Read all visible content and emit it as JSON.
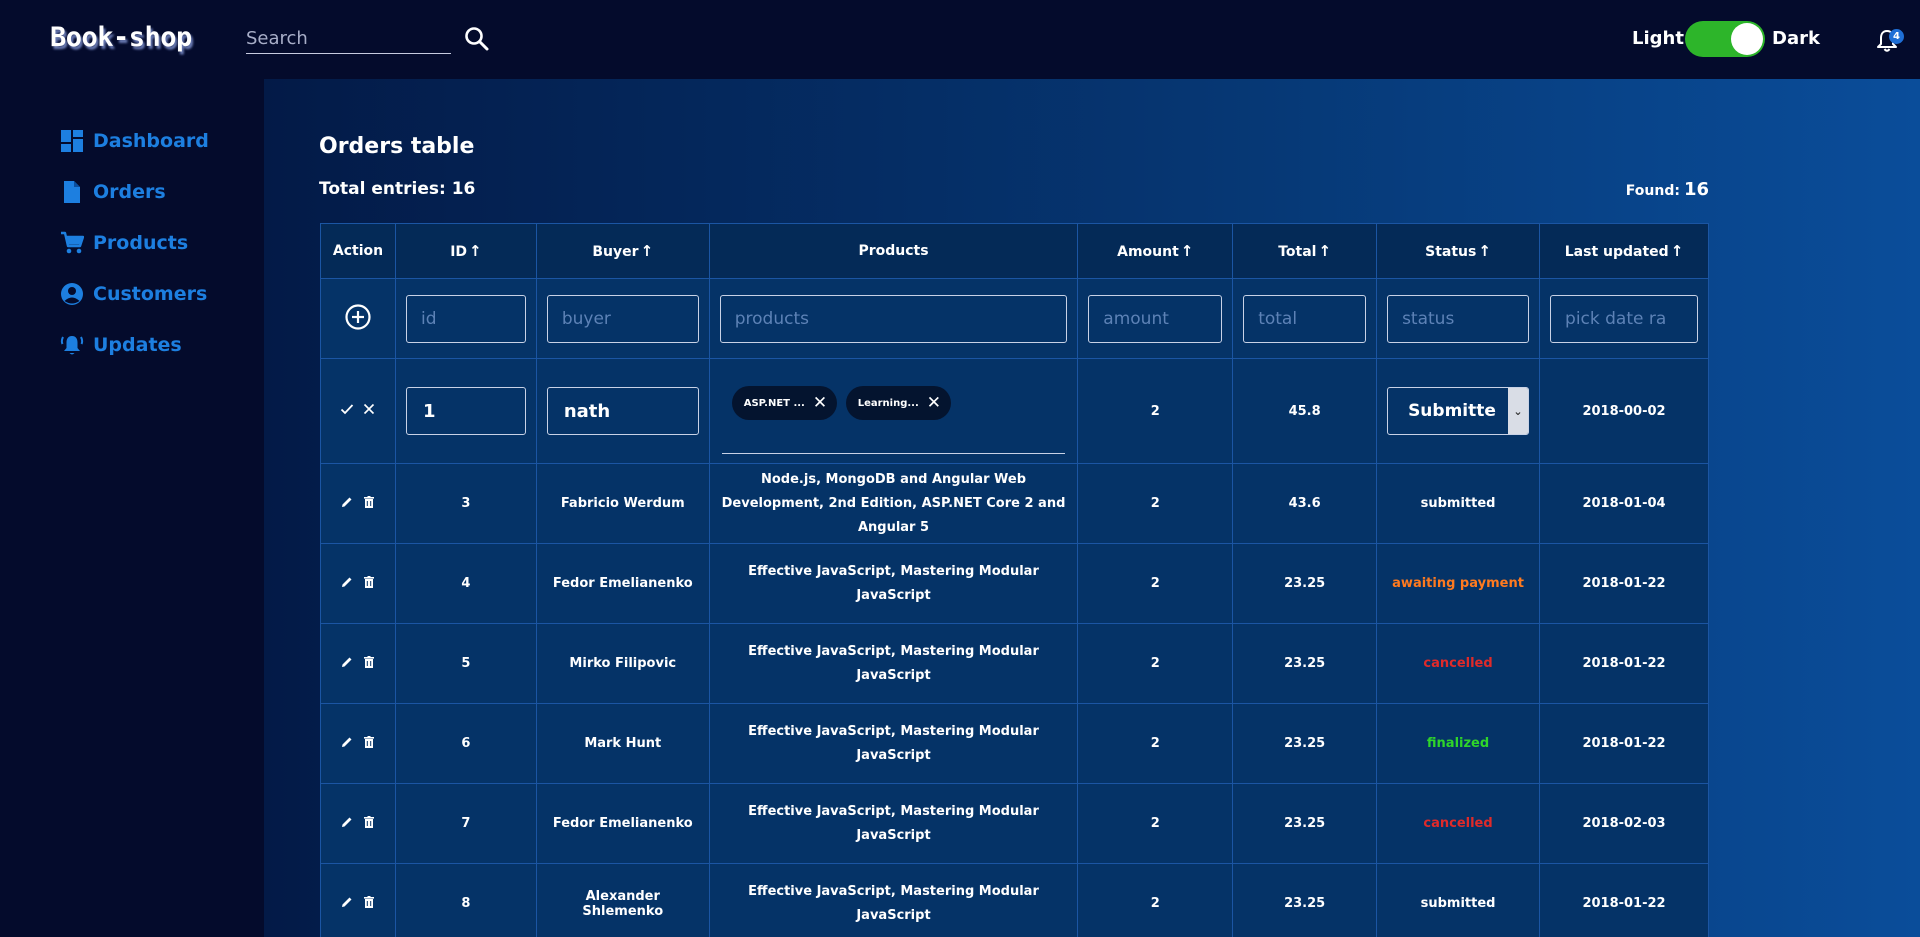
{
  "app": {
    "logo": "Book-shop"
  },
  "search": {
    "placeholder": "Search"
  },
  "theme": {
    "light_label": "Light",
    "dark_label": "Dark",
    "is_dark": true
  },
  "notifications": {
    "count": "4"
  },
  "sidebar": {
    "items": [
      {
        "label": "Dashboard",
        "icon": "dashboard-icon"
      },
      {
        "label": "Orders",
        "icon": "document-icon"
      },
      {
        "label": "Products",
        "icon": "cart-icon"
      },
      {
        "label": "Customers",
        "icon": "user-circle-icon"
      },
      {
        "label": "Updates",
        "icon": "bell-ringing-icon"
      }
    ]
  },
  "page": {
    "title": "Orders table",
    "total_entries_label": "Total entries: 16",
    "found_label": "Found:",
    "found_count": "16"
  },
  "table": {
    "headers": {
      "action": "Action",
      "id": "ID",
      "buyer": "Buyer",
      "products": "Products",
      "amount": "Amount",
      "total": "Total",
      "status": "Status",
      "last_updated": "Last updated"
    },
    "filters": {
      "id": "id",
      "buyer": "buyer",
      "products": "products",
      "amount": "amount",
      "total": "total",
      "status": "status",
      "last_updated": "pick date ra"
    },
    "edit_row": {
      "id": "1",
      "buyer": "nath",
      "products": [
        "ASP.NET ...",
        "Learning..."
      ],
      "amount": "2",
      "total": "45.8",
      "status": "Submitte",
      "last_updated": "2018-00-02"
    },
    "rows": [
      {
        "id": "3",
        "buyer": "Fabricio Werdum",
        "products": "Node.js, MongoDB and Angular Web Development, 2nd Edition, ASP.NET Core 2 and Angular 5",
        "amount": "2",
        "total": "43.6",
        "status": "submitted",
        "last_updated": "2018-01-04"
      },
      {
        "id": "4",
        "buyer": "Fedor Emelianenko",
        "products": "Effective JavaScript, Mastering Modular JavaScript",
        "amount": "2",
        "total": "23.25",
        "status": "awaiting payment",
        "last_updated": "2018-01-22"
      },
      {
        "id": "5",
        "buyer": "Mirko Filipovic",
        "products": "Effective JavaScript, Mastering Modular JavaScript",
        "amount": "2",
        "total": "23.25",
        "status": "cancelled",
        "last_updated": "2018-01-22"
      },
      {
        "id": "6",
        "buyer": "Mark Hunt",
        "products": "Effective JavaScript, Mastering Modular JavaScript",
        "amount": "2",
        "total": "23.25",
        "status": "finalized",
        "last_updated": "2018-01-22"
      },
      {
        "id": "7",
        "buyer": "Fedor Emelianenko",
        "products": "Effective JavaScript, Mastering Modular JavaScript",
        "amount": "2",
        "total": "23.25",
        "status": "cancelled",
        "last_updated": "2018-02-03"
      },
      {
        "id": "8",
        "buyer": "Alexander Shlemenko",
        "products": "Effective JavaScript, Mastering Modular JavaScript",
        "amount": "2",
        "total": "23.25",
        "status": "submitted",
        "last_updated": "2018-01-22"
      }
    ]
  },
  "colors": {
    "accent": "#1d7fe0",
    "status_submitted": "#ffffff",
    "status_awaiting": "#ff7a1f",
    "status_cancelled": "#e02a2a",
    "status_finalized": "#2fd52a",
    "toggle_on": "#2db52a"
  }
}
